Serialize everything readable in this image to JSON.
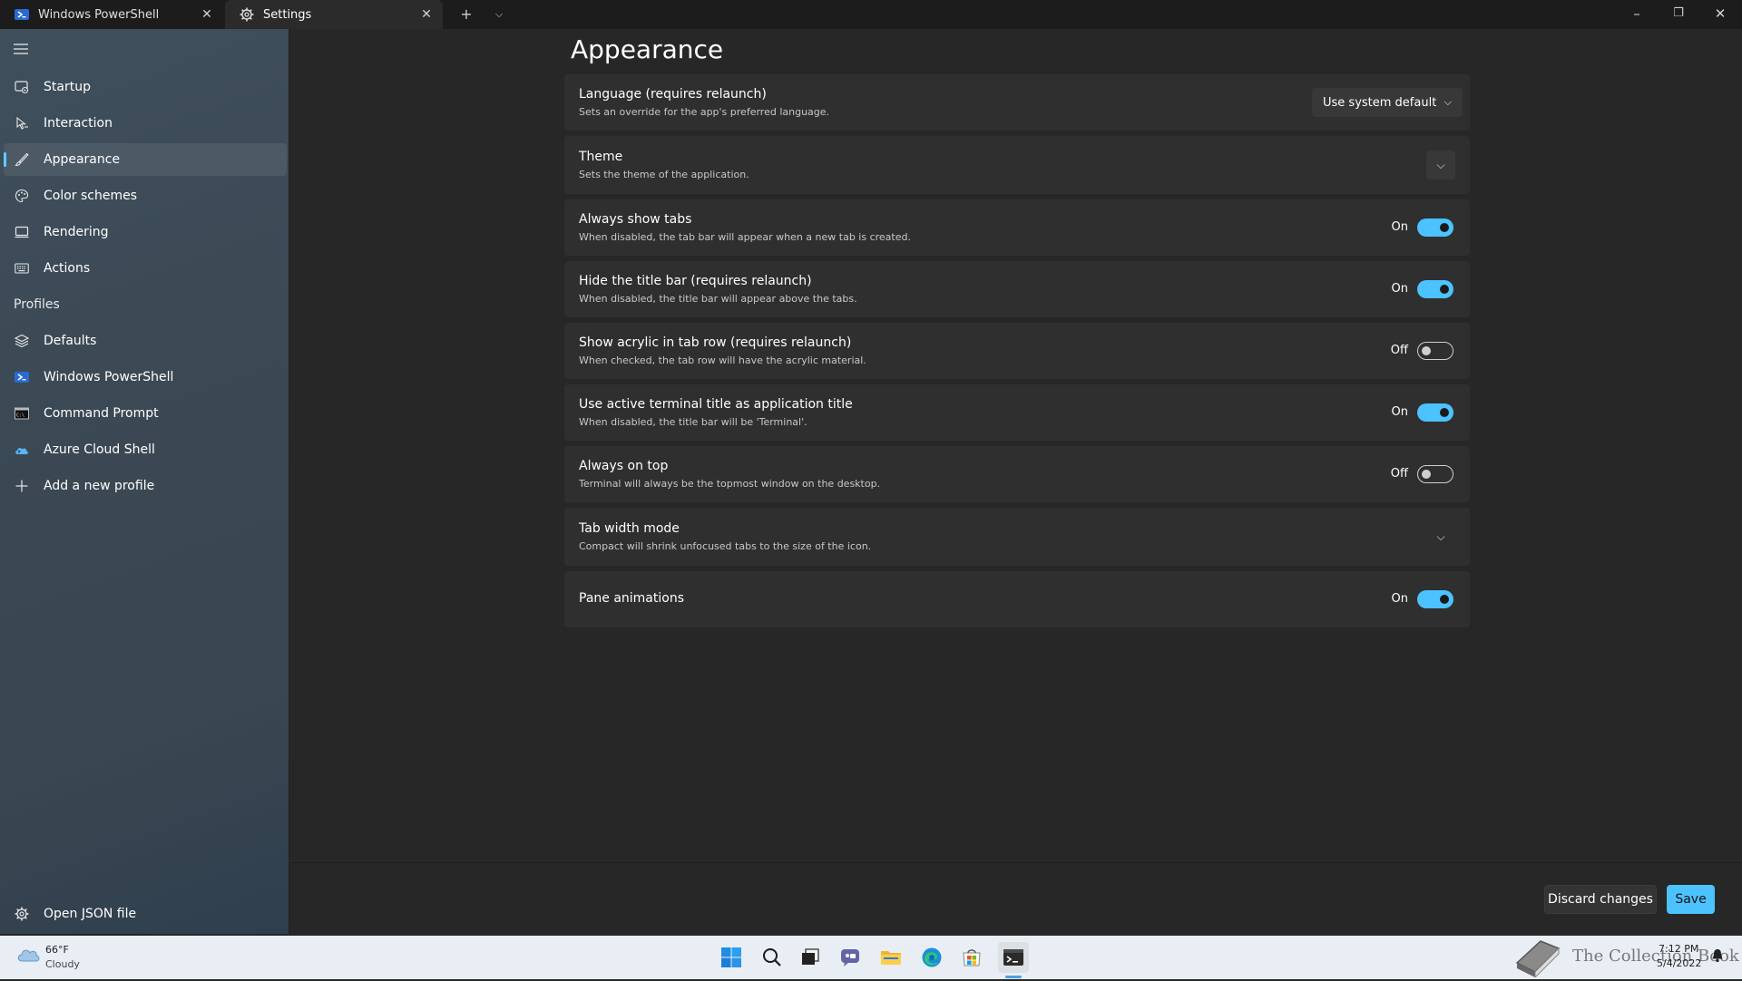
{
  "tabs": [
    {
      "label": "Windows PowerShell",
      "icon": "powershell-icon"
    },
    {
      "label": "Settings",
      "icon": "gear-icon"
    }
  ],
  "sidebar": {
    "items": [
      {
        "label": "Startup",
        "icon": "startup-icon"
      },
      {
        "label": "Interaction",
        "icon": "interaction-icon"
      },
      {
        "label": "Appearance",
        "icon": "paintbrush-icon",
        "selected": true
      },
      {
        "label": "Color schemes",
        "icon": "palette-icon"
      },
      {
        "label": "Rendering",
        "icon": "monitor-icon"
      },
      {
        "label": "Actions",
        "icon": "keyboard-icon"
      }
    ],
    "profiles_header": "Profiles",
    "profiles": [
      {
        "label": "Defaults",
        "icon": "layers-icon"
      },
      {
        "label": "Windows PowerShell",
        "icon": "powershell-icon"
      },
      {
        "label": "Command Prompt",
        "icon": "cmd-icon"
      },
      {
        "label": "Azure Cloud Shell",
        "icon": "azure-icon"
      },
      {
        "label": "Add a new profile",
        "icon": "plus-icon"
      }
    ],
    "open_json": "Open JSON file"
  },
  "main": {
    "title": "Appearance",
    "settings": [
      {
        "title": "Language (requires relaunch)",
        "desc": "Sets an override for the app's preferred language.",
        "control": "combo",
        "value": "Use system default"
      },
      {
        "title": "Theme",
        "desc": "Sets the theme of the application.",
        "control": "chevron"
      },
      {
        "title": "Always show tabs",
        "desc": "When disabled, the tab bar will appear when a new tab is created.",
        "control": "toggle",
        "state": "On"
      },
      {
        "title": "Hide the title bar (requires relaunch)",
        "desc": "When disabled, the title bar will appear above the tabs.",
        "control": "toggle",
        "state": "On"
      },
      {
        "title": "Show acrylic in tab row (requires relaunch)",
        "desc": "When checked, the tab row will have the acrylic material.",
        "control": "toggle",
        "state": "Off"
      },
      {
        "title": "Use active terminal title as application title",
        "desc": "When disabled, the title bar will be 'Terminal'.",
        "control": "toggle",
        "state": "On"
      },
      {
        "title": "Always on top",
        "desc": "Terminal will always be the topmost window on the desktop.",
        "control": "toggle",
        "state": "Off"
      },
      {
        "title": "Tab width mode",
        "desc": "Compact will shrink unfocused tabs to the size of the icon.",
        "control": "chevron"
      },
      {
        "title": "Pane animations",
        "desc": "",
        "control": "toggle",
        "state": "On"
      }
    ]
  },
  "footer": {
    "discard_label": "Discard changes",
    "save_label": "Save"
  },
  "taskbar": {
    "weather_temp": "66°F",
    "weather_desc": "Cloudy",
    "watermark": "The Collection Book",
    "time": "7:12 PM",
    "date": "5/4/2022"
  },
  "colors": {
    "accent": "#4cc2ff",
    "background": "#272727",
    "card": "#2f2f2f"
  }
}
